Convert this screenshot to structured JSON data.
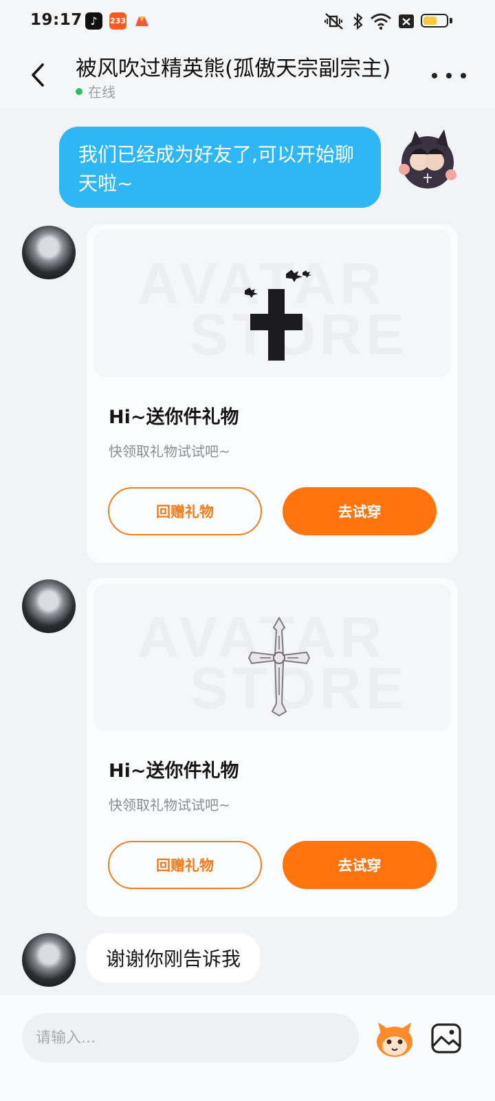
{
  "status_bar": {
    "time": "19:17",
    "app_badge_233": "233"
  },
  "header": {
    "title": "被风吹过精英熊(孤傲天宗副宗主)",
    "status": "在线"
  },
  "messages": {
    "system_mine": "我们已经成为好友了,可以开始聊天啦~",
    "gift_cards": [
      {
        "title": "Hi~送你件礼物",
        "subtitle": "快领取礼物试试吧~",
        "return_gift_label": "回赠礼物",
        "try_on_label": "去试穿",
        "watermark_line1": "AVATAR",
        "watermark_line2": "STORE",
        "item_icon": "dark-cross-with-bats-icon"
      },
      {
        "title": "Hi~送你件礼物",
        "subtitle": "快领取礼物试试吧~",
        "return_gift_label": "回赠礼物",
        "try_on_label": "去试穿",
        "watermark_line1": "AVATAR",
        "watermark_line2": "STORE",
        "item_icon": "silver-ornate-cross-icon"
      }
    ],
    "peer_text": "谢谢你刚告诉我"
  },
  "input": {
    "placeholder": "请输入..."
  },
  "colors": {
    "accent_orange": "#ff740f",
    "bubble_blue": "#2fb6f5",
    "online_green": "#21c45d"
  }
}
